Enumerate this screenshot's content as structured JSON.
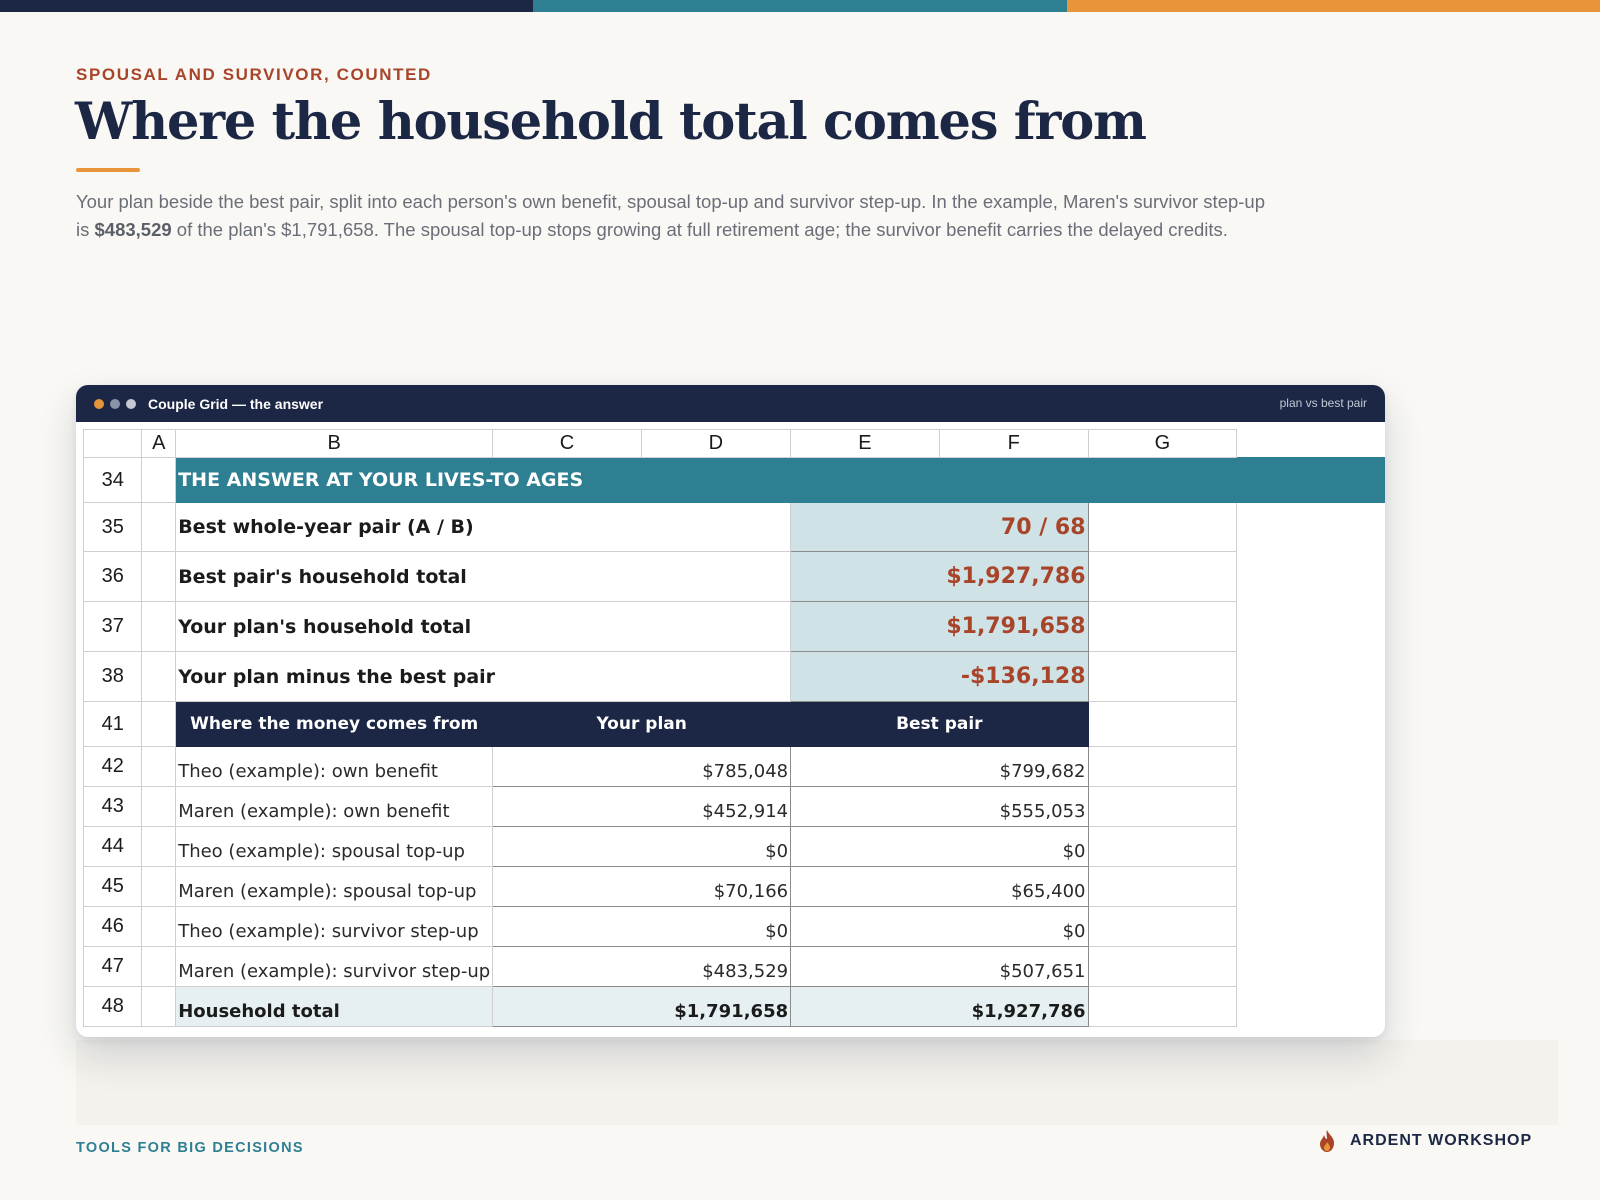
{
  "colors": {
    "navy": "#1c2745",
    "teal": "#2f7f93",
    "orange": "#e8943a",
    "rust": "#a8442a"
  },
  "header": {
    "eyebrow": "SPOUSAL AND SURVIVOR, COUNTED",
    "title": "Where the household total comes from",
    "intro_a": "Your plan beside the best pair, split into each person's own benefit, spousal top-up and survivor step-up. In the example, Maren's survivor step-up is ",
    "intro_highlight": "$483,529",
    "intro_b": " of the plan's $1,791,658. The spousal top-up stops growing at full retirement age; the survivor benefit carries the delayed credits."
  },
  "window": {
    "title": "Couple Grid — the answer",
    "tag": "plan vs best pair"
  },
  "grid": {
    "columns": [
      "A",
      "B",
      "C",
      "D",
      "E",
      "F",
      "G"
    ],
    "band": {
      "row": "34",
      "text": "THE ANSWER AT YOUR LIVES-TO AGES"
    },
    "answers": [
      {
        "row": "35",
        "label": "Best whole-year pair (A / B)",
        "value": "70 / 68"
      },
      {
        "row": "36",
        "label": "Best pair's household total",
        "value": "$1,927,786"
      },
      {
        "row": "37",
        "label": "Your plan's household total",
        "value": "$1,791,658"
      },
      {
        "row": "38",
        "label": "Your plan minus the best pair",
        "value": "-$136,128"
      }
    ],
    "detail_header": {
      "row": "41",
      "col1": "Where the money comes from",
      "col2": "Your plan",
      "col3": "Best pair"
    },
    "detail_rows": [
      {
        "row": "42",
        "name": "Theo (example): own benefit",
        "plan": "$785,048",
        "best": "$799,682"
      },
      {
        "row": "43",
        "name": "Maren (example): own benefit",
        "plan": "$452,914",
        "best": "$555,053"
      },
      {
        "row": "44",
        "name": "Theo (example): spousal top-up",
        "plan": "$0",
        "best": "$0"
      },
      {
        "row": "45",
        "name": "Maren (example): spousal top-up",
        "plan": "$70,166",
        "best": "$65,400"
      },
      {
        "row": "46",
        "name": "Theo (example): survivor step-up",
        "plan": "$0",
        "best": "$0"
      },
      {
        "row": "47",
        "name": "Maren (example): survivor step-up",
        "plan": "$483,529",
        "best": "$507,651"
      }
    ],
    "total": {
      "row": "48",
      "name": "Household total",
      "plan": "$1,791,658",
      "best": "$1,927,786"
    }
  },
  "footer": {
    "left": "TOOLS FOR BIG DECISIONS",
    "brand": "ARDENT WORKSHOP"
  }
}
